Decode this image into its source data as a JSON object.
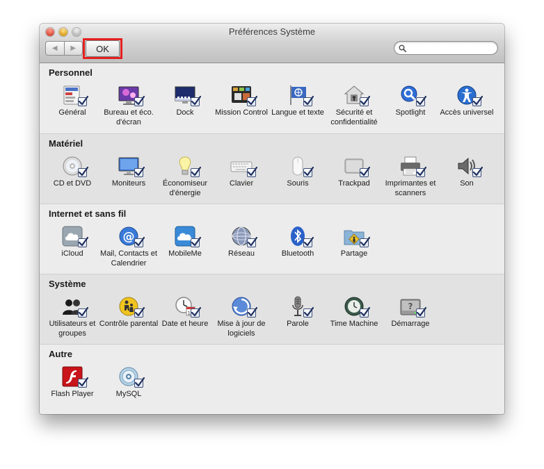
{
  "window": {
    "title": "Préférences Système",
    "ok_label": "OK",
    "nav_back": "◀",
    "nav_forward": "▶",
    "search_value": ""
  },
  "sections": [
    {
      "title": "Personnel",
      "items": [
        {
          "label": "Général",
          "icon": "general-icon"
        },
        {
          "label": "Bureau et éco. d'écran",
          "icon": "desktop-icon"
        },
        {
          "label": "Dock",
          "icon": "dock-icon"
        },
        {
          "label": "Mission Control",
          "icon": "mission-control-icon"
        },
        {
          "label": "Langue et texte",
          "icon": "language-flag-icon"
        },
        {
          "label": "Sécurité et confidentialité",
          "icon": "security-house-icon"
        },
        {
          "label": "Spotlight",
          "icon": "spotlight-icon"
        },
        {
          "label": "Accès universel",
          "icon": "accessibility-icon"
        }
      ]
    },
    {
      "title": "Matériel",
      "items": [
        {
          "label": "CD et DVD",
          "icon": "cd-dvd-icon"
        },
        {
          "label": "Moniteurs",
          "icon": "monitor-icon"
        },
        {
          "label": "Économiseur d'énergie",
          "icon": "bulb-icon"
        },
        {
          "label": "Clavier",
          "icon": "keyboard-icon"
        },
        {
          "label": "Souris",
          "icon": "mouse-icon"
        },
        {
          "label": "Trackpad",
          "icon": "trackpad-icon"
        },
        {
          "label": "Imprimantes et scanners",
          "icon": "printer-icon"
        },
        {
          "label": "Son",
          "icon": "speaker-icon"
        }
      ]
    },
    {
      "title": "Internet et sans fil",
      "items": [
        {
          "label": "iCloud",
          "icon": "icloud-icon"
        },
        {
          "label": "Mail, Contacts et Calendrier",
          "icon": "mail-at-icon"
        },
        {
          "label": "MobileMe",
          "icon": "mobileme-icon"
        },
        {
          "label": "Réseau",
          "icon": "network-globe-icon"
        },
        {
          "label": "Bluetooth",
          "icon": "bluetooth-icon"
        },
        {
          "label": "Partage",
          "icon": "sharing-folder-icon"
        }
      ]
    },
    {
      "title": "Système",
      "items": [
        {
          "label": "Utilisateurs et groupes",
          "icon": "users-icon"
        },
        {
          "label": "Contrôle parental",
          "icon": "parental-control-icon"
        },
        {
          "label": "Date et heure",
          "icon": "clock-calendar-icon"
        },
        {
          "label": "Mise à jour de logiciels",
          "icon": "software-update-icon"
        },
        {
          "label": "Parole",
          "icon": "microphone-icon"
        },
        {
          "label": "Time Machine",
          "icon": "time-machine-icon"
        },
        {
          "label": "Démarrage",
          "icon": "startup-disk-icon"
        }
      ]
    },
    {
      "title": "Autre",
      "items": [
        {
          "label": "Flash Player",
          "icon": "flash-player-icon"
        },
        {
          "label": "MySQL",
          "icon": "mysql-icon"
        }
      ]
    }
  ]
}
